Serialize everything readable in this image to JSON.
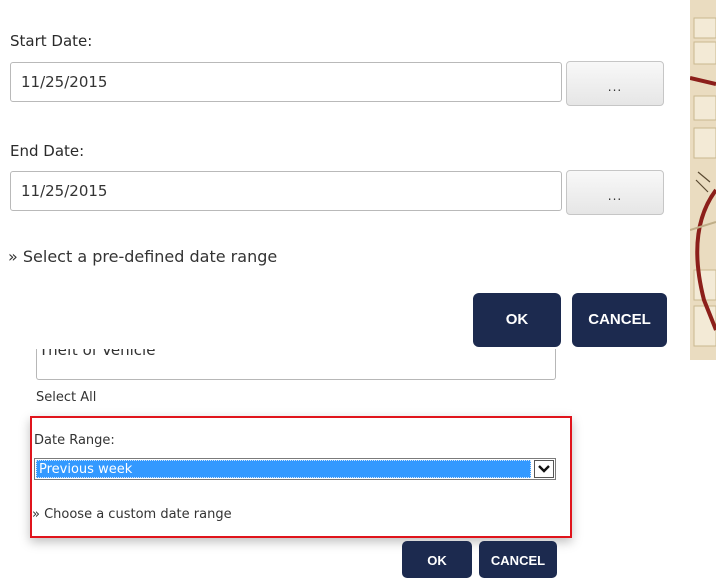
{
  "top_dialog": {
    "start_label": "Start Date:",
    "start_value": "11/25/2015",
    "start_picker": "...",
    "end_label": "End Date:",
    "end_value": "11/25/2015",
    "end_picker": "...",
    "predefined_link": "» Select a pre-defined date range",
    "ok": "OK",
    "cancel": "CANCEL"
  },
  "bottom_dialog": {
    "partial_field_value": "Theft of Vehicle",
    "select_all": "Select All",
    "date_range_label": "Date Range:",
    "date_range_selected": "Previous week",
    "custom_link": "» Choose a custom date range",
    "ok": "OK",
    "cancel": "CANCEL"
  },
  "colors": {
    "navy_button": "#1c2a4f",
    "highlight_border": "#e0141c",
    "selection_blue": "#3399ff"
  }
}
